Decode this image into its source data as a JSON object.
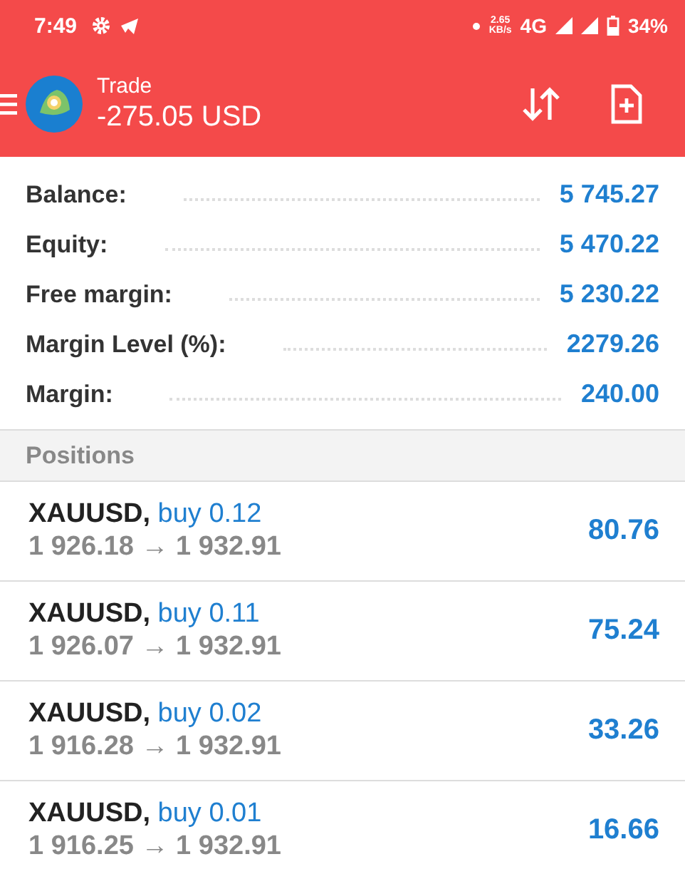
{
  "status_bar": {
    "time": "7:49",
    "speed": "2.65",
    "speed_unit": "KB/s",
    "network": "4G",
    "battery": "34%"
  },
  "header": {
    "title": "Trade",
    "profit": "-275.05 USD"
  },
  "summary": [
    {
      "label": "Balance:",
      "value": "5 745.27"
    },
    {
      "label": "Equity:",
      "value": "5 470.22"
    },
    {
      "label": "Free margin:",
      "value": "5 230.22"
    },
    {
      "label": "Margin Level (%):",
      "value": "2279.26"
    },
    {
      "label": "Margin:",
      "value": "240.00"
    }
  ],
  "positions_heading": "Positions",
  "positions": [
    {
      "symbol": "XAUUSD,",
      "order": "buy 0.12",
      "open_price": "1 926.18",
      "arrow": "→",
      "current_price": "1 932.91",
      "profit": "80.76"
    },
    {
      "symbol": "XAUUSD,",
      "order": "buy 0.11",
      "open_price": "1 926.07",
      "arrow": "→",
      "current_price": "1 932.91",
      "profit": "75.24"
    },
    {
      "symbol": "XAUUSD,",
      "order": "buy 0.02",
      "open_price": "1 916.28",
      "arrow": "→",
      "current_price": "1 932.91",
      "profit": "33.26"
    },
    {
      "symbol": "XAUUSD,",
      "order": "buy 0.01",
      "open_price": "1 916.25",
      "arrow": "→",
      "current_price": "1 932.91",
      "profit": "16.66"
    }
  ]
}
